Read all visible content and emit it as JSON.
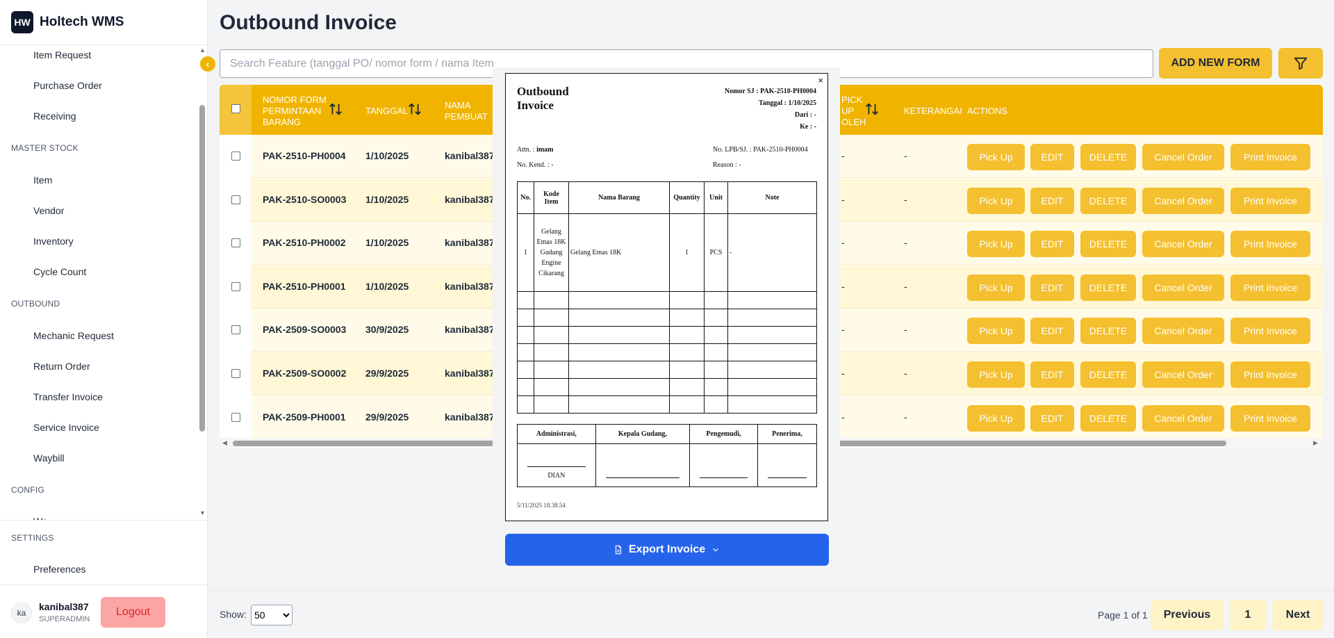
{
  "brand": {
    "logo": "HW",
    "name": "Holtech WMS"
  },
  "sidebar": {
    "items_top": [
      "Item Request",
      "Purchase Order",
      "Receiving"
    ],
    "section_master": "MASTER STOCK",
    "items_master": [
      "Item",
      "Vendor",
      "Inventory",
      "Cycle Count"
    ],
    "section_outbound": "OUTBOUND",
    "items_outbound": [
      "Mechanic Request",
      "Return Order",
      "Transfer Invoice",
      "Service Invoice",
      "Waybill"
    ],
    "section_config": "CONFIG",
    "config_partial": "Wa",
    "section_settings": "SETTINGS",
    "item_settings": "Preferences",
    "collapse_icon": "chevron-left-icon"
  },
  "user": {
    "initials": "ka",
    "name": "kanibal387",
    "role": "SUPERADMIN",
    "logout": "Logout"
  },
  "page": {
    "title": "Outbound Invoice"
  },
  "search": {
    "placeholder": "Search Feature (tanggal PO/ nomor form / nama Item"
  },
  "toolbar": {
    "add_label": "ADD NEW FORM",
    "filter_icon": "filter-icon"
  },
  "table": {
    "headers": {
      "nomor": [
        "NOMOR FORM",
        "PERMINTAAN",
        "BARANG"
      ],
      "tanggal": "TANGGAL",
      "nama": [
        "NAMA",
        "PEMBUAT"
      ],
      "pickup": [
        "PICK",
        "UP",
        "OLEH"
      ],
      "keterangan": "KETERANGAI",
      "actions": "ACTIONS"
    },
    "rows": [
      {
        "nomor": "PAK-2510-PH0004",
        "tanggal": "1/10/2025",
        "nama": "kanibal387",
        "pickup": "-",
        "keterangan": "-"
      },
      {
        "nomor": "PAK-2510-SO0003",
        "tanggal": "1/10/2025",
        "nama": "kanibal387",
        "pickup": "-",
        "keterangan": "-"
      },
      {
        "nomor": "PAK-2510-PH0002",
        "tanggal": "1/10/2025",
        "nama": "kanibal387",
        "pickup": "-",
        "keterangan": "-"
      },
      {
        "nomor": "PAK-2510-PH0001",
        "tanggal": "1/10/2025",
        "nama": "kanibal387",
        "pickup": "-",
        "keterangan": "-"
      },
      {
        "nomor": "PAK-2509-SO0003",
        "tanggal": "30/9/2025",
        "nama": "kanibal387",
        "pickup": "-",
        "keterangan": "-"
      },
      {
        "nomor": "PAK-2509-SO0002",
        "tanggal": "29/9/2025",
        "nama": "kanibal387",
        "pickup": "-",
        "keterangan": "-"
      },
      {
        "nomor": "PAK-2509-PH0001",
        "tanggal": "29/9/2025",
        "nama": "kanibal387",
        "pickup": "-",
        "keterangan": "-"
      }
    ],
    "actions": {
      "pickup": "Pick Up",
      "edit": "EDIT",
      "delete": "DELETE",
      "cancel": "Cancel Order",
      "print": "Print Invoice"
    }
  },
  "footer": {
    "show_label": "Show:",
    "show_value": "50",
    "page_info": "Page 1 of 1",
    "previous": "Previous",
    "current": "1",
    "next": "Next"
  },
  "invoice": {
    "close": "×",
    "title_line1": "Outbound",
    "title_line2": "Invoice",
    "nomor_sj": "Nomor SJ : PAK-2510-PH0004",
    "tanggal": "Tanggal : 1/10/2025",
    "dari": "Dari : -",
    "ke": "Ke : -",
    "attn_label": "Attn. : ",
    "attn_value": "imam",
    "no_kend": "No. Kend. : -",
    "no_lpb": "No. LPB/SJ. : PAK-2510-PH0004",
    "reason": "Reason : -",
    "table_headers": {
      "no": "No.",
      "kode": "Kode Item",
      "nama": "Nama  Barang",
      "qty": "Quantity",
      "unit": "Unit",
      "note": "Note"
    },
    "item": {
      "no": "1",
      "kode": "Gelang Emas 18K Gudang Engine Cikarang",
      "nama": "Gelang Emas 18K",
      "qty": "1",
      "unit": "PCS",
      "note": "-"
    },
    "sign_headers": [
      "Administrasi,",
      "Kepala Gudang,",
      "Pengemudi,",
      "Penerima,"
    ],
    "admin_name": "DIAN",
    "timestamp": "5/11/2025 18.38.54"
  },
  "export": {
    "label": "Export Invoice"
  }
}
